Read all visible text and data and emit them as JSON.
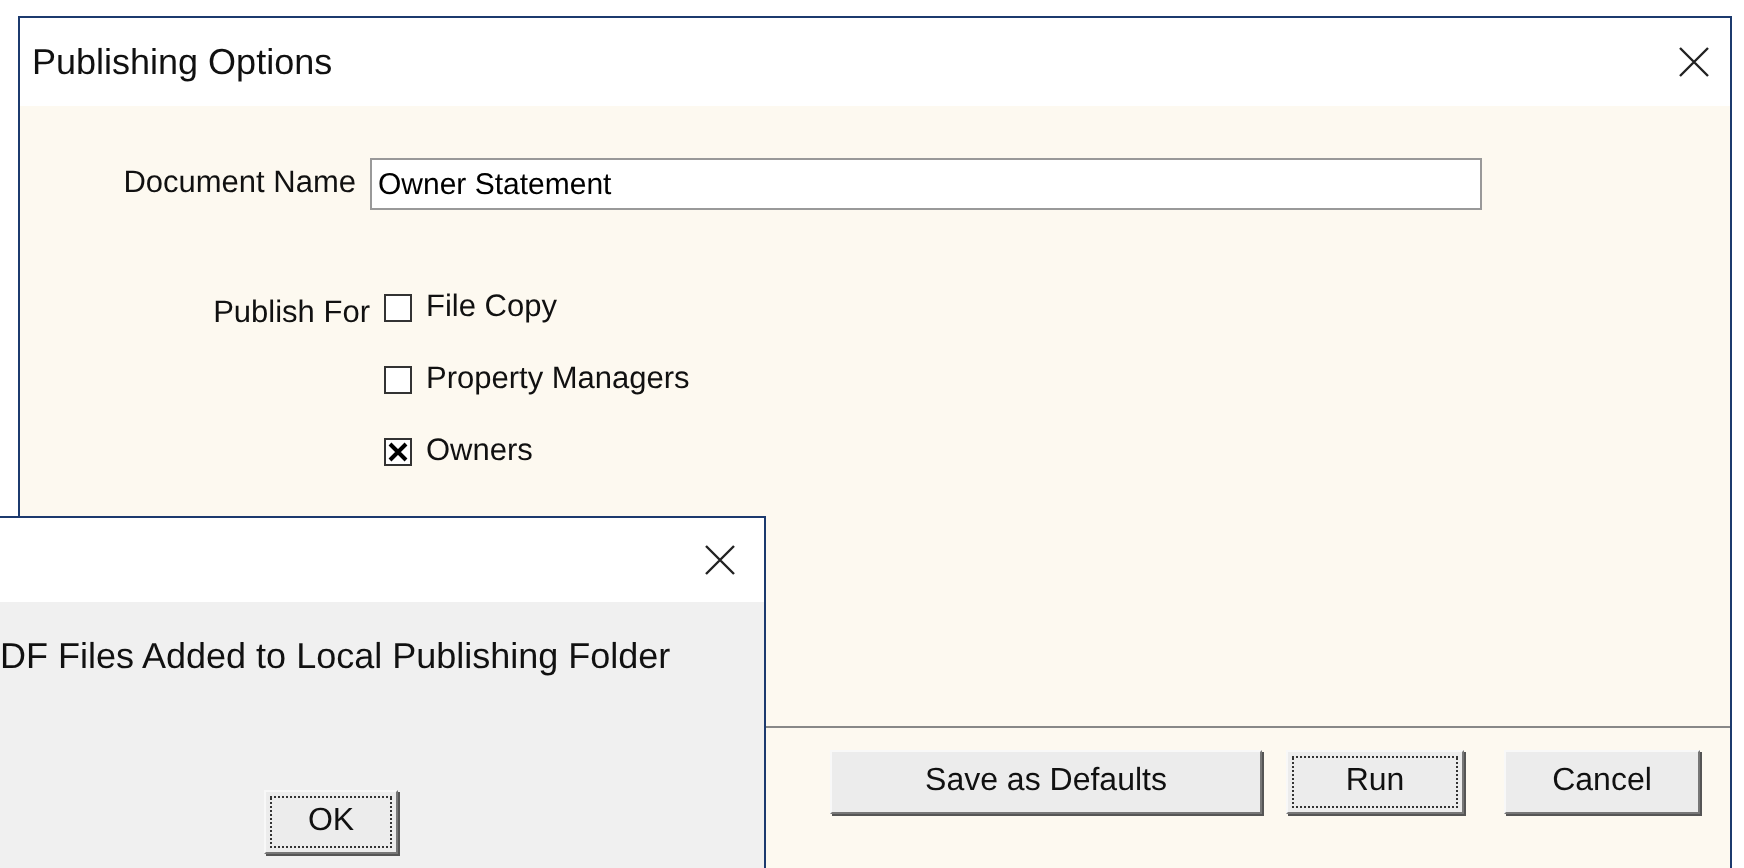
{
  "window": {
    "title": "Publishing Options"
  },
  "document_name": {
    "label": "Document Name",
    "value": "Owner Statement"
  },
  "publish_for": {
    "label": "Publish For",
    "options": [
      {
        "label": "File Copy",
        "checked": false
      },
      {
        "label": "Property Managers",
        "checked": false
      },
      {
        "label": "Owners",
        "checked": true
      }
    ]
  },
  "buttons": [
    {
      "label": "Save as Defaults",
      "focused": false
    },
    {
      "label": "Run",
      "focused": true
    },
    {
      "label": "Cancel",
      "focused": false
    }
  ],
  "message_box": {
    "message": "DF Files Added to Local Publishing Folder",
    "button": {
      "label": "OK",
      "focused": true
    }
  }
}
